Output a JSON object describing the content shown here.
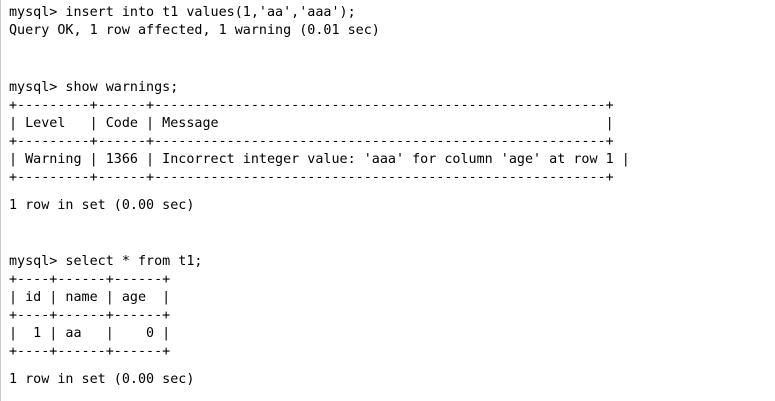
{
  "terminal": {
    "lines": [
      "mysql> insert into t1 values(1,'aa','aaa');",
      "Query OK, 1 row affected, 1 warning (0.01 sec)",
      "",
      "mysql> show warnings;",
      "+---------+------+--------------------------------------------------------+",
      "| Level   | Code | Message                                                |",
      "+---------+------+--------------------------------------------------------+",
      "| Warning | 1366 | Incorrect integer value: 'aaa' for column 'age' at row 1 |",
      "+---------+------+--------------------------------------------------------+",
      "1 row in set (0.00 sec)",
      "",
      "mysql> select * from t1;",
      "+----+------+------+",
      "| id | name | age  |",
      "+----+------+------+",
      "|  1 | aa   |    0 |",
      "+----+------+------+",
      "1 row in set (0.00 sec)"
    ]
  }
}
